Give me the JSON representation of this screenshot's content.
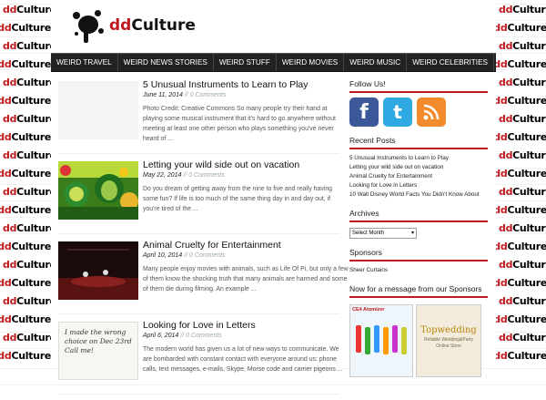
{
  "background": {
    "tile_red": "dd",
    "tile_black": "Culture"
  },
  "logo": {
    "red": "dd",
    "black": "Culture"
  },
  "nav": [
    "WEIRD TRAVEL",
    "WEIRD NEWS STORIES",
    "WEIRD STUFF",
    "WEIRD MOVIES",
    "WEIRD MUSIC",
    "WEIRD CELEBRITIES"
  ],
  "posts": [
    {
      "title": "5 Unusual Instruments to Learn to Play",
      "date": "June 11, 2014",
      "comments": "// 0 Comments",
      "excerpt": "Photo Credit: Creative Commons So many people try their hand at playing some musical instrument that it's hard to go anywhere without meeting at least one other person who plays something you've never heard of ..."
    },
    {
      "title": "Letting your wild side out on vacation",
      "date": "May 22, 2014",
      "comments": "// 0 Comments",
      "excerpt": "Do you dream of getting away from the nine to five and really having some fun? If life is too much of the same thing day in and day out, if you're tired of the ..."
    },
    {
      "title": "Animal Cruelty for Entertainment",
      "date": "April 10, 2014",
      "comments": "// 0 Comments",
      "excerpt": "Many people enjoy movies with animals, such as Life Of Pi, but only a few of them know the shocking truth that many animals are harmed and some of them die during filming. An example ..."
    },
    {
      "title": "Looking for Love in Letters",
      "date": "April 6, 2014",
      "comments": "// 0 Comments",
      "excerpt": "The modern world has given us a lot of new ways to communicate. We are bombarded with constant contact with everyone around us: phone calls, text messages, e-mails, Skype, Morse code and carrier pigeons ...",
      "thumb_text": "I made the wrong choice on Dec 23rd Call me!"
    }
  ],
  "sidebar": {
    "follow_title": "Follow Us!",
    "social": [
      {
        "icon": "facebook-icon",
        "glyph": "f",
        "color": "#3b5998"
      },
      {
        "icon": "twitter-icon",
        "glyph": "t",
        "color": "#2fa9e1"
      },
      {
        "icon": "rss-icon",
        "glyph": ")",
        "color": "#f28b2c"
      }
    ],
    "recent_title": "Recent Posts",
    "recent": [
      "5 Unusual Instruments to Learn to Play",
      "Letting your wild side out on vacation",
      "Animal Cruelty for Entertainment",
      "Looking for Love in Letters",
      "10 Walt Disney World Facts You Didn't Know About"
    ],
    "archives_title": "Archives",
    "archives_select": "Select Month",
    "sponsors_title": "Sponsors",
    "sponsor": "Sheer Curtains",
    "message_title": "Now for a message from our Sponsors",
    "ad1_text": "CE4 Atomizer",
    "ad2_title": "Topwedding",
    "ad2_sub": "Reliable Wedding&Party Online Store"
  },
  "colors": {
    "accent": "#c0191f",
    "nav_bg": "#222222"
  }
}
